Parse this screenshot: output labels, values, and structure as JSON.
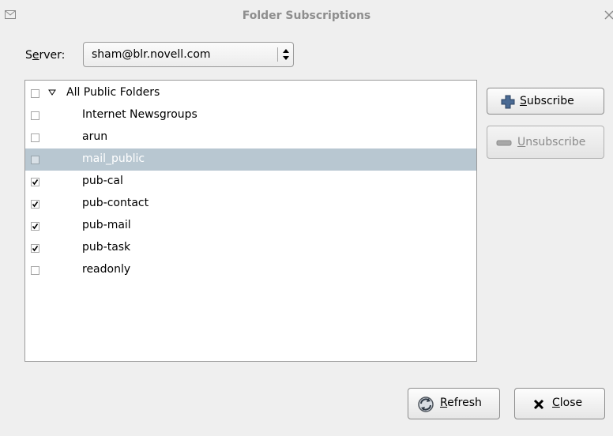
{
  "window": {
    "title": "Folder Subscriptions",
    "icon": "envelope-icon",
    "close_icon": "close-icon"
  },
  "server": {
    "label_prefix": "S",
    "label_mnemonic": "e",
    "label_suffix": "rver:",
    "selected": "sham@blr.novell.com"
  },
  "tree": {
    "root": {
      "label": "All Public Folders",
      "checked": false,
      "expanded": true
    },
    "items": [
      {
        "label": "Internet Newsgroups",
        "checked": false,
        "selected": false
      },
      {
        "label": "arun",
        "checked": false,
        "selected": false
      },
      {
        "label": "mail_public",
        "checked": false,
        "selected": true
      },
      {
        "label": "pub-cal",
        "checked": true,
        "selected": false
      },
      {
        "label": "pub-contact",
        "checked": true,
        "selected": false
      },
      {
        "label": "pub-mail",
        "checked": true,
        "selected": false
      },
      {
        "label": "pub-task",
        "checked": true,
        "selected": false
      },
      {
        "label": "readonly",
        "checked": false,
        "selected": false
      }
    ]
  },
  "buttons": {
    "subscribe": {
      "mnemonic": "S",
      "rest": "ubscribe",
      "icon": "plus-icon",
      "enabled": true
    },
    "unsubscribe": {
      "mnemonic": "U",
      "rest": "nsubscribe",
      "icon": "minus-icon",
      "enabled": false
    },
    "refresh": {
      "mnemonic": "R",
      "rest": "efresh",
      "icon": "refresh-icon",
      "enabled": true
    },
    "close": {
      "mnemonic": "C",
      "rest": "lose",
      "icon": "x-icon",
      "enabled": true
    }
  },
  "colors": {
    "selection": "#b8c7d1",
    "subscribe_icon": "#3f5f87"
  }
}
